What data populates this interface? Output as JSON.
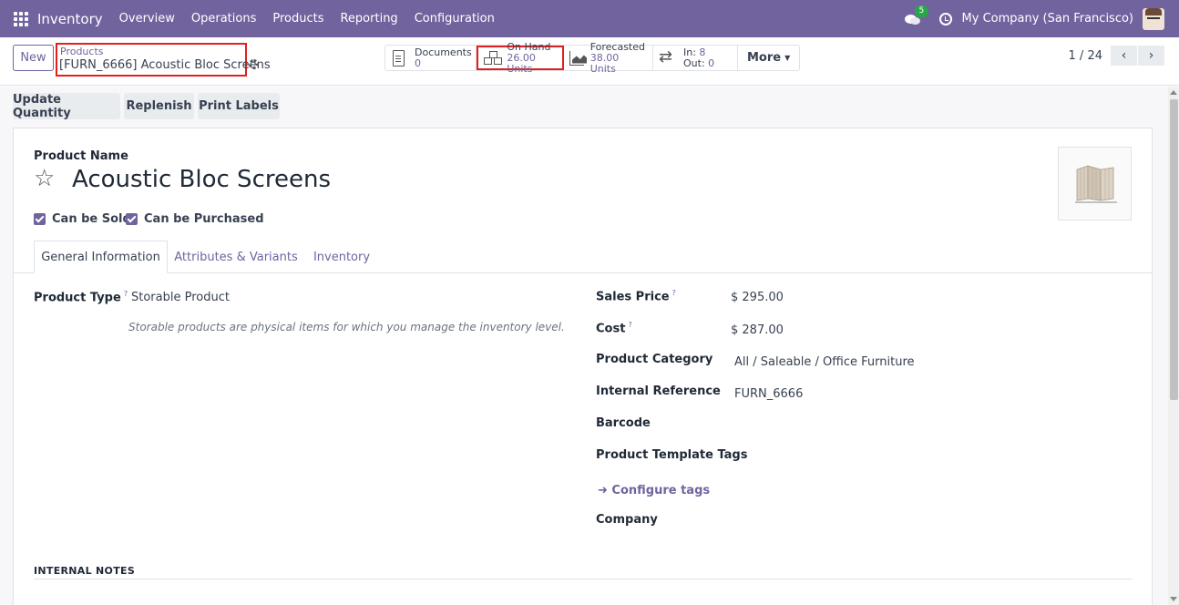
{
  "navbar": {
    "app_name": "Inventory",
    "menu": [
      "Overview",
      "Operations",
      "Products",
      "Reporting",
      "Configuration"
    ],
    "chat_badge": "5",
    "company": "My Company (San Francisco)"
  },
  "control": {
    "new_label": "New",
    "breadcrumb_parent": "Products",
    "breadcrumb_current": "[FURN_6666] Acoustic Bloc Screens",
    "smart_buttons": {
      "documents": {
        "label": "Documents",
        "value": "0"
      },
      "on_hand": {
        "label": "On Hand",
        "value": "26.00 Units"
      },
      "forecasted": {
        "label": "Forecasted",
        "value": "38.00 Units"
      },
      "in_out": {
        "in_label": "In:",
        "in_value": "8",
        "out_label": "Out:",
        "out_value": "0"
      },
      "more": "More"
    },
    "pager": "1 / 24"
  },
  "actions": [
    "Update Quantity",
    "Replenish",
    "Print Labels"
  ],
  "form": {
    "name_label": "Product Name",
    "name": "Acoustic Bloc Screens",
    "can_be_sold": "Can be Sold",
    "can_be_purchased": "Can be Purchased",
    "tabs": [
      "General Information",
      "Attributes & Variants",
      "Inventory"
    ],
    "product_type_label": "Product Type",
    "product_type_value": "Storable Product",
    "product_type_help": "Storable products are physical items for which you manage the inventory level.",
    "help_mark": "?",
    "sales_price_label": "Sales Price",
    "sales_price_value": "$ 295.00",
    "cost_label": "Cost",
    "cost_value": "$ 287.00",
    "category_label": "Product Category",
    "category_value": "All / Saleable / Office Furniture",
    "internal_ref_label": "Internal Reference",
    "internal_ref_value": "FURN_6666",
    "barcode_label": "Barcode",
    "tags_label": "Product Template Tags",
    "configure_tags": "➜ Configure tags",
    "company_label": "Company",
    "internal_notes": "INTERNAL NOTES"
  },
  "colors": {
    "brand": "#71639e",
    "highlight": "#e02020",
    "badge": "#28a745"
  }
}
